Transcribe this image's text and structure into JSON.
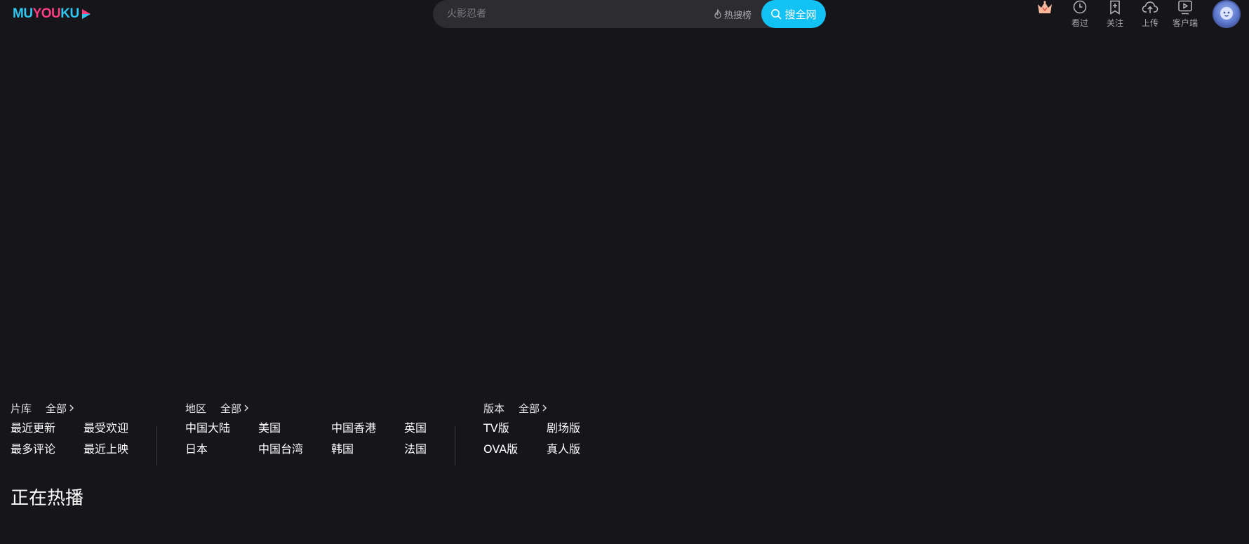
{
  "brand": {
    "logo_part1": "MU",
    "logo_part2": "YOU",
    "logo_part3": "KU"
  },
  "search": {
    "placeholder": "火影忍者",
    "hot_rank_label": "热搜榜",
    "button_label": "搜全网"
  },
  "toolbar": {
    "items": [
      {
        "label": "看过",
        "icon": "clock-icon"
      },
      {
        "label": "关注",
        "icon": "bookmark-add-icon"
      },
      {
        "label": "上传",
        "icon": "cloud-upload-icon"
      },
      {
        "label": "客户端",
        "icon": "tv-client-icon"
      }
    ]
  },
  "filters": {
    "library": {
      "title": "片库",
      "all_label": "全部",
      "options": [
        "最近更新",
        "最受欢迎",
        "最多评论",
        "最近上映"
      ]
    },
    "region": {
      "title": "地区",
      "all_label": "全部",
      "options": [
        "中国大陆",
        "美国",
        "中国香港",
        "英国",
        "日本",
        "中国台湾",
        "韩国",
        "法国"
      ]
    },
    "version": {
      "title": "版本",
      "all_label": "全部",
      "options": [
        "TV版",
        "剧场版",
        "OVA版",
        "真人版"
      ]
    }
  },
  "sections": {
    "now_playing_title": "正在热播"
  },
  "colors": {
    "background": "#16161a",
    "accent": "#13c2f5",
    "brand_pink": "#ff3d7f",
    "brand_cyan": "#2fc7f1"
  }
}
